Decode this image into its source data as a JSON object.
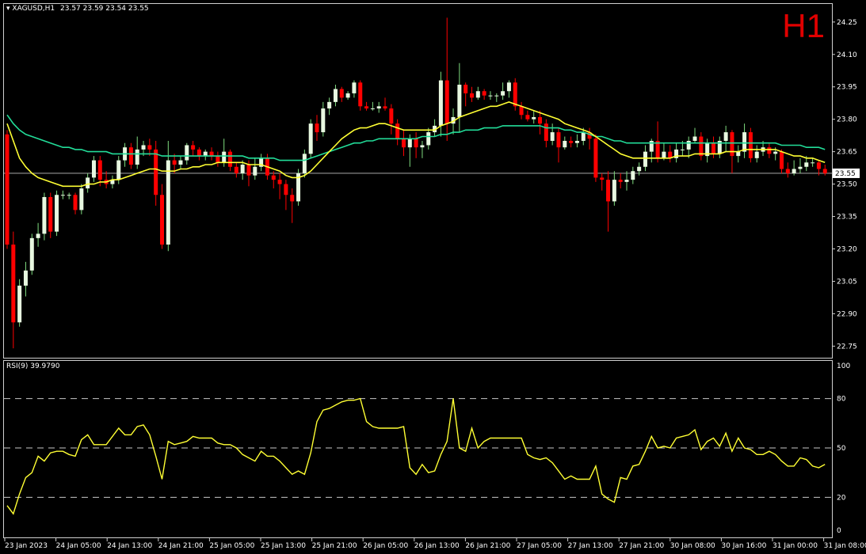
{
  "header": {
    "symbol": "XAGUSD,H1",
    "ohlc": "23.57 23.59 23.54 23.55",
    "timeframe_label": "H1"
  },
  "rsi_panel": {
    "label": "RSI(9) 39.9790"
  },
  "colors": {
    "background": "#000000",
    "bull": "#e8f8e0",
    "bear": "#ff0000",
    "ma_fast": "#ffff33",
    "ma_slow": "#22dd99",
    "rsi": "#ffff33",
    "grid": "#cccccc",
    "timeframe": "#e00000"
  },
  "chart_data": [
    {
      "type": "candlestick",
      "title": "XAGUSD,H1",
      "y_ticks": [
        "24.25",
        "24.10",
        "23.95",
        "23.80",
        "23.65",
        "23.50",
        "23.35",
        "23.20",
        "23.05",
        "22.90",
        "22.75"
      ],
      "ylim": [
        22.7,
        24.33
      ],
      "current_price": "23.55",
      "x_labels": [
        "23 Jan 2023",
        "24 Jan 05:00",
        "24 Jan 13:00",
        "24 Jan 21:00",
        "25 Jan 05:00",
        "25 Jan 13:00",
        "25 Jan 21:00",
        "26 Jan 05:00",
        "26 Jan 13:00",
        "26 Jan 21:00",
        "27 Jan 05:00",
        "27 Jan 13:00",
        "27 Jan 21:00",
        "30 Jan 08:00",
        "30 Jan 16:00",
        "31 Jan 00:00",
        "31 Jan 08:00"
      ],
      "candles": [
        [
          23.73,
          23.22,
          23.75,
          23.2
        ],
        [
          23.22,
          22.86,
          23.28,
          22.74
        ],
        [
          22.86,
          23.03,
          23.06,
          22.84
        ],
        [
          23.03,
          23.1,
          23.14,
          22.98
        ],
        [
          23.1,
          23.25,
          23.27,
          23.08
        ],
        [
          23.25,
          23.27,
          23.32,
          23.21
        ],
        [
          23.27,
          23.44,
          23.46,
          23.24
        ],
        [
          23.44,
          23.28,
          23.46,
          23.25
        ],
        [
          23.28,
          23.45,
          23.47,
          23.26
        ],
        [
          23.45,
          23.45,
          23.47,
          23.43
        ],
        [
          23.45,
          23.45,
          23.46,
          23.43
        ],
        [
          23.45,
          23.38,
          23.46,
          23.36
        ],
        [
          23.38,
          23.48,
          23.5,
          23.36
        ],
        [
          23.48,
          23.53,
          23.55,
          23.46
        ],
        [
          23.53,
          23.61,
          23.63,
          23.51
        ],
        [
          23.61,
          23.52,
          23.63,
          23.49
        ],
        [
          23.52,
          23.5,
          23.56,
          23.48
        ],
        [
          23.5,
          23.52,
          23.54,
          23.48
        ],
        [
          23.52,
          23.61,
          23.63,
          23.5
        ],
        [
          23.61,
          23.67,
          23.69,
          23.58
        ],
        [
          23.67,
          23.59,
          23.69,
          23.57
        ],
        [
          23.59,
          23.66,
          23.72,
          23.57
        ],
        [
          23.66,
          23.68,
          23.7,
          23.63
        ],
        [
          23.68,
          23.66,
          23.71,
          23.63
        ],
        [
          23.66,
          23.45,
          23.7,
          23.4
        ],
        [
          23.45,
          23.22,
          23.5,
          23.2
        ],
        [
          23.22,
          23.61,
          23.7,
          23.19
        ],
        [
          23.61,
          23.59,
          23.64,
          23.55
        ],
        [
          23.59,
          23.61,
          23.63,
          23.57
        ],
        [
          23.61,
          23.68,
          23.69,
          23.59
        ],
        [
          23.68,
          23.66,
          23.7,
          23.63
        ],
        [
          23.66,
          23.63,
          23.67,
          23.61
        ],
        [
          23.63,
          23.65,
          23.66,
          23.61
        ],
        [
          23.65,
          23.63,
          23.67,
          23.61
        ],
        [
          23.63,
          23.6,
          23.65,
          23.58
        ],
        [
          23.6,
          23.65,
          23.71,
          23.58
        ],
        [
          23.65,
          23.58,
          23.66,
          23.56
        ],
        [
          23.58,
          23.55,
          23.6,
          23.53
        ],
        [
          23.55,
          23.59,
          23.61,
          23.52
        ],
        [
          23.59,
          23.54,
          23.61,
          23.49
        ],
        [
          23.54,
          23.58,
          23.62,
          23.52
        ],
        [
          23.58,
          23.62,
          23.64,
          23.56
        ],
        [
          23.62,
          23.54,
          23.64,
          23.52
        ],
        [
          23.54,
          23.52,
          23.56,
          23.48
        ],
        [
          23.52,
          23.5,
          23.55,
          23.43
        ],
        [
          23.5,
          23.45,
          23.52,
          23.38
        ],
        [
          23.45,
          23.42,
          23.48,
          23.32
        ],
        [
          23.42,
          23.55,
          23.57,
          23.4
        ],
        [
          23.55,
          23.64,
          23.66,
          23.53
        ],
        [
          23.64,
          23.78,
          23.8,
          23.62
        ],
        [
          23.78,
          23.74,
          23.82,
          23.7
        ],
        [
          23.74,
          23.85,
          23.88,
          23.72
        ],
        [
          23.85,
          23.88,
          23.9,
          23.82
        ],
        [
          23.88,
          23.94,
          23.96,
          23.86
        ],
        [
          23.94,
          23.9,
          23.95,
          23.88
        ],
        [
          23.9,
          23.92,
          23.93,
          23.89
        ],
        [
          23.92,
          23.97,
          23.98,
          23.9
        ],
        [
          23.97,
          23.86,
          23.98,
          23.84
        ],
        [
          23.86,
          23.85,
          23.88,
          23.84
        ],
        [
          23.85,
          23.85,
          23.88,
          23.84
        ],
        [
          23.85,
          23.86,
          23.88,
          23.83
        ],
        [
          23.86,
          23.85,
          23.9,
          23.84
        ],
        [
          23.85,
          23.78,
          23.87,
          23.73
        ],
        [
          23.78,
          23.71,
          23.8,
          23.68
        ],
        [
          23.71,
          23.67,
          23.75,
          23.63
        ],
        [
          23.67,
          23.71,
          23.73,
          23.58
        ],
        [
          23.71,
          23.67,
          23.74,
          23.62
        ],
        [
          23.67,
          23.68,
          23.7,
          23.62
        ],
        [
          23.68,
          23.74,
          23.76,
          23.66
        ],
        [
          23.74,
          23.77,
          23.8,
          23.72
        ],
        [
          23.77,
          23.98,
          24.02,
          23.72
        ],
        [
          23.98,
          23.78,
          24.27,
          23.7
        ],
        [
          23.78,
          23.81,
          23.85,
          23.73
        ],
        [
          23.81,
          23.96,
          24.06,
          23.74
        ],
        [
          23.96,
          23.92,
          23.97,
          23.86
        ],
        [
          23.92,
          23.9,
          23.95,
          23.88
        ],
        [
          23.9,
          23.93,
          23.95,
          23.89
        ],
        [
          23.93,
          23.91,
          23.94,
          23.89
        ],
        [
          23.91,
          23.91,
          23.93,
          23.89
        ],
        [
          23.91,
          23.91,
          23.92,
          23.88
        ],
        [
          23.91,
          23.93,
          23.97,
          23.89
        ],
        [
          23.93,
          23.97,
          23.98,
          23.9
        ],
        [
          23.97,
          23.86,
          23.99,
          23.84
        ],
        [
          23.86,
          23.82,
          23.88,
          23.8
        ],
        [
          23.82,
          23.8,
          23.84,
          23.79
        ],
        [
          23.8,
          23.81,
          23.84,
          23.78
        ],
        [
          23.81,
          23.78,
          23.84,
          23.73
        ],
        [
          23.78,
          23.7,
          23.8,
          23.67
        ],
        [
          23.7,
          23.74,
          23.78,
          23.68
        ],
        [
          23.74,
          23.67,
          23.76,
          23.6
        ],
        [
          23.67,
          23.7,
          23.72,
          23.66
        ],
        [
          23.7,
          23.69,
          23.72,
          23.67
        ],
        [
          23.69,
          23.7,
          23.73,
          23.67
        ],
        [
          23.7,
          23.74,
          23.76,
          23.68
        ],
        [
          23.74,
          23.71,
          23.76,
          23.66
        ],
        [
          23.71,
          23.53,
          23.73,
          23.51
        ],
        [
          23.53,
          23.52,
          23.55,
          23.47
        ],
        [
          23.52,
          23.42,
          23.56,
          23.28
        ],
        [
          23.42,
          23.52,
          23.56,
          23.4
        ],
        [
          23.52,
          23.51,
          23.55,
          23.48
        ],
        [
          23.51,
          23.52,
          23.56,
          23.47
        ],
        [
          23.52,
          23.56,
          23.58,
          23.5
        ],
        [
          23.56,
          23.58,
          23.6,
          23.54
        ],
        [
          23.58,
          23.65,
          23.68,
          23.56
        ],
        [
          23.65,
          23.7,
          23.71,
          23.6
        ],
        [
          23.7,
          23.62,
          23.79,
          23.6
        ],
        [
          23.62,
          23.65,
          23.69,
          23.61
        ],
        [
          23.65,
          23.62,
          23.68,
          23.6
        ],
        [
          23.62,
          23.66,
          23.69,
          23.6
        ],
        [
          23.66,
          23.66,
          23.7,
          23.63
        ],
        [
          23.66,
          23.7,
          23.72,
          23.62
        ],
        [
          23.7,
          23.72,
          23.76,
          23.69
        ],
        [
          23.72,
          23.63,
          23.74,
          23.61
        ],
        [
          23.63,
          23.69,
          23.71,
          23.6
        ],
        [
          23.69,
          23.64,
          23.72,
          23.62
        ],
        [
          23.64,
          23.7,
          23.72,
          23.62
        ],
        [
          23.7,
          23.74,
          23.77,
          23.65
        ],
        [
          23.74,
          23.63,
          23.75,
          23.55
        ],
        [
          23.63,
          23.65,
          23.68,
          23.6
        ],
        [
          23.65,
          23.74,
          23.78,
          23.62
        ],
        [
          23.74,
          23.62,
          23.76,
          23.6
        ],
        [
          23.62,
          23.65,
          23.68,
          23.6
        ],
        [
          23.65,
          23.67,
          23.7,
          23.63
        ],
        [
          23.67,
          23.64,
          23.69,
          23.62
        ],
        [
          23.64,
          23.65,
          23.67,
          23.61
        ],
        [
          23.65,
          23.57,
          23.66,
          23.55
        ],
        [
          23.57,
          23.55,
          23.6,
          23.53
        ],
        [
          23.55,
          23.57,
          23.61,
          23.54
        ],
        [
          23.57,
          23.58,
          23.62,
          23.55
        ],
        [
          23.58,
          23.6,
          23.63,
          23.56
        ],
        [
          23.6,
          23.6,
          23.62,
          23.58
        ],
        [
          23.6,
          23.57,
          23.61,
          23.54
        ],
        [
          23.57,
          23.55,
          23.59,
          23.54
        ]
      ],
      "ma_fast": [
        23.78,
        23.7,
        23.62,
        23.58,
        23.55,
        23.53,
        23.52,
        23.51,
        23.5,
        23.49,
        23.49,
        23.49,
        23.49,
        23.5,
        23.5,
        23.51,
        23.51,
        23.52,
        23.52,
        23.53,
        23.54,
        23.55,
        23.56,
        23.57,
        23.57,
        23.56,
        23.56,
        23.56,
        23.57,
        23.57,
        23.58,
        23.58,
        23.59,
        23.59,
        23.6,
        23.6,
        23.6,
        23.6,
        23.6,
        23.59,
        23.59,
        23.59,
        23.58,
        23.57,
        23.56,
        23.54,
        23.53,
        23.53,
        23.54,
        23.56,
        23.59,
        23.62,
        23.65,
        23.68,
        23.71,
        23.73,
        23.75,
        23.76,
        23.76,
        23.77,
        23.78,
        23.78,
        23.77,
        23.76,
        23.75,
        23.75,
        23.75,
        23.75,
        23.75,
        23.75,
        23.77,
        23.78,
        23.79,
        23.81,
        23.82,
        23.83,
        23.84,
        23.85,
        23.86,
        23.86,
        23.87,
        23.88,
        23.87,
        23.86,
        23.85,
        23.84,
        23.83,
        23.82,
        23.81,
        23.8,
        23.78,
        23.77,
        23.76,
        23.75,
        23.74,
        23.72,
        23.7,
        23.68,
        23.66,
        23.64,
        23.63,
        23.62,
        23.62,
        23.62,
        23.62,
        23.62,
        23.62,
        23.62,
        23.63,
        23.63,
        23.63,
        23.64,
        23.64,
        23.64,
        23.64,
        23.64,
        23.65,
        23.65,
        23.65,
        23.66,
        23.66,
        23.66,
        23.66,
        23.66,
        23.66,
        23.65,
        23.64,
        23.63,
        23.63,
        23.62,
        23.62,
        23.61,
        23.6
      ],
      "ma_slow": [
        23.82,
        23.78,
        23.75,
        23.73,
        23.72,
        23.71,
        23.7,
        23.69,
        23.68,
        23.67,
        23.67,
        23.66,
        23.66,
        23.65,
        23.65,
        23.65,
        23.65,
        23.64,
        23.64,
        23.64,
        23.64,
        23.64,
        23.64,
        23.64,
        23.64,
        23.63,
        23.63,
        23.63,
        23.63,
        23.63,
        23.63,
        23.63,
        23.63,
        23.63,
        23.63,
        23.63,
        23.63,
        23.63,
        23.63,
        23.62,
        23.62,
        23.62,
        23.62,
        23.62,
        23.61,
        23.61,
        23.61,
        23.61,
        23.61,
        23.62,
        23.63,
        23.64,
        23.65,
        23.66,
        23.67,
        23.68,
        23.69,
        23.69,
        23.7,
        23.7,
        23.71,
        23.71,
        23.71,
        23.71,
        23.71,
        23.71,
        23.71,
        23.72,
        23.72,
        23.72,
        23.73,
        23.73,
        23.74,
        23.74,
        23.75,
        23.75,
        23.75,
        23.76,
        23.76,
        23.76,
        23.77,
        23.77,
        23.77,
        23.77,
        23.77,
        23.77,
        23.77,
        23.76,
        23.76,
        23.76,
        23.75,
        23.75,
        23.74,
        23.74,
        23.73,
        23.72,
        23.72,
        23.71,
        23.7,
        23.7,
        23.69,
        23.69,
        23.69,
        23.69,
        23.69,
        23.69,
        23.69,
        23.69,
        23.69,
        23.69,
        23.69,
        23.69,
        23.69,
        23.69,
        23.69,
        23.69,
        23.69,
        23.69,
        23.69,
        23.69,
        23.69,
        23.69,
        23.69,
        23.69,
        23.69,
        23.68,
        23.68,
        23.68,
        23.68,
        23.67,
        23.67,
        23.67,
        23.66
      ]
    },
    {
      "type": "line",
      "title": "RSI(9) 39.9790",
      "y_ticks": [
        "100",
        "80",
        "50",
        "20",
        "0"
      ],
      "ylim": [
        0,
        100
      ],
      "levels": [
        20,
        50,
        80
      ],
      "values": [
        15,
        10,
        22,
        32,
        35,
        45,
        42,
        47,
        48,
        48,
        46,
        45,
        55,
        58,
        52,
        52,
        52,
        57,
        62,
        58,
        58,
        63,
        64,
        58,
        45,
        31,
        54,
        52,
        53,
        54,
        57,
        56,
        56,
        56,
        53,
        52,
        52,
        50,
        46,
        44,
        42,
        48,
        45,
        45,
        42,
        38,
        34,
        36,
        34,
        47,
        66,
        73,
        74,
        76,
        78,
        79,
        79,
        80,
        66,
        63,
        62,
        62,
        62,
        62,
        63,
        38,
        34,
        40,
        35,
        36,
        46,
        54,
        80,
        50,
        48,
        62,
        50,
        54,
        56,
        56,
        56,
        56,
        56,
        56,
        46,
        44,
        43,
        44,
        41,
        36,
        31,
        33,
        31,
        31,
        31,
        39,
        22,
        19,
        17,
        32,
        31,
        39,
        40,
        48,
        57,
        50,
        51,
        50,
        56,
        57,
        58,
        61,
        49,
        54,
        56,
        51,
        59,
        48,
        56,
        50,
        49,
        46,
        46,
        48,
        46,
        42,
        39,
        39,
        44,
        43,
        39,
        38,
        40
      ]
    }
  ]
}
